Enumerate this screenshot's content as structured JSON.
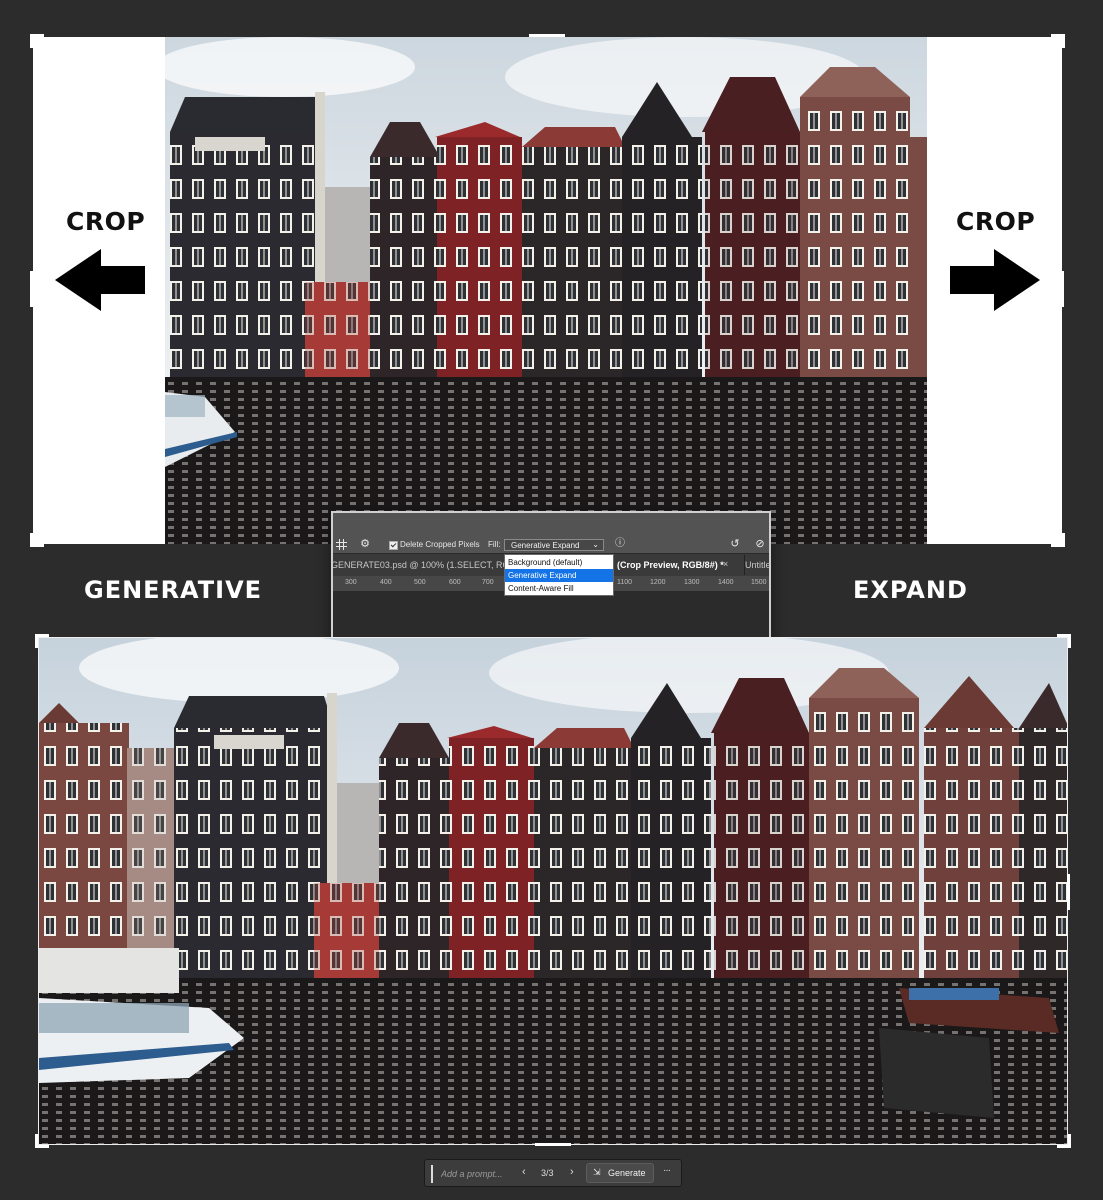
{
  "top": {
    "crop_left_label": "CROP",
    "crop_right_label": "CROP"
  },
  "labels": {
    "generative": "GENERATIVE",
    "expand": "EXPAND"
  },
  "photoshop": {
    "delete_cropped_label": "Delete Cropped Pixels",
    "fill_label": "Fill:",
    "fill_selected": "Generative Expand",
    "fill_options": [
      "Background (default)",
      "Generative Expand",
      "Content-Aware Fill"
    ],
    "tab_1": "GENERATE03.psd @ 100% (1.SELECT, RGB/8",
    "tab_2": "(Crop Preview, RGB/8#) *",
    "tab_2_close": "×",
    "tab_3": "Untitle",
    "ruler_ticks": [
      "300",
      "400",
      "500",
      "600",
      "700",
      "1100",
      "1200",
      "1300",
      "1400",
      "1500"
    ]
  },
  "taskbar": {
    "prompt_placeholder": "Add a prompt...",
    "page_indicator": "3/3",
    "generate_label": "Generate",
    "more_label": "···"
  },
  "colors": {
    "background": "#2c2c2c",
    "accent_blue": "#1473e6",
    "crop_border": "#ffffff"
  }
}
